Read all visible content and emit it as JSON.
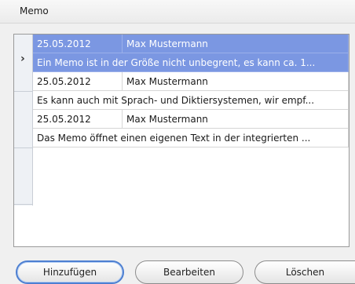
{
  "window": {
    "title": "Memo"
  },
  "records": [
    {
      "date": "25.05.2012",
      "name": "Max Mustermann",
      "memo": "Ein Memo ist in der Größe nicht unbegrent, es kann ca. 1..."
    },
    {
      "date": "25.05.2012",
      "name": "Max Mustermann",
      "memo": "Es kann auch mit Sprach- und Diktiersystemen, wir empf..."
    },
    {
      "date": "25.05.2012",
      "name": "Max Mustermann",
      "memo": "Das Memo öffnet einen eigenen Text in der integrierten ..."
    }
  ],
  "selected_index": 0,
  "row_indicator": "›",
  "buttons": {
    "add": "Hinzufügen",
    "edit": "Bearbeiten",
    "delete": "Löschen"
  },
  "colors": {
    "selection": "#7b97e2",
    "focus_border": "#4d7fd1"
  }
}
